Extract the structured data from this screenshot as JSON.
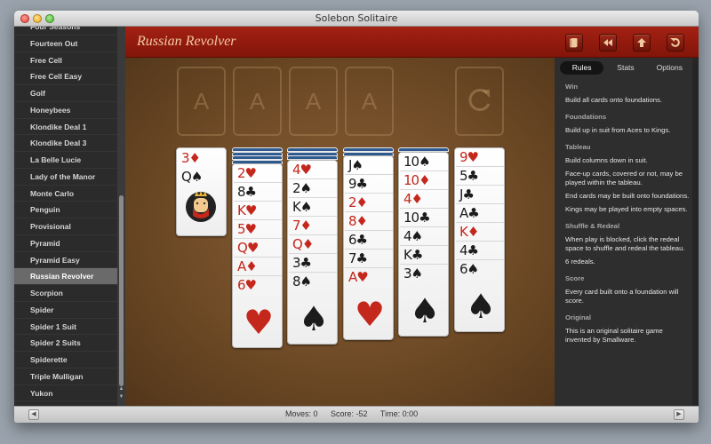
{
  "window": {
    "title": "Solebon Solitaire"
  },
  "sidebar": {
    "items": [
      {
        "label": "Four Seasons"
      },
      {
        "label": "Fourteen Out"
      },
      {
        "label": "Free Cell"
      },
      {
        "label": "Free Cell Easy"
      },
      {
        "label": "Golf"
      },
      {
        "label": "Honeybees"
      },
      {
        "label": "Klondike Deal 1"
      },
      {
        "label": "Klondike Deal 3"
      },
      {
        "label": "La Belle Lucie"
      },
      {
        "label": "Lady of the Manor"
      },
      {
        "label": "Monte Carlo"
      },
      {
        "label": "Penguin"
      },
      {
        "label": "Provisional"
      },
      {
        "label": "Pyramid"
      },
      {
        "label": "Pyramid Easy"
      },
      {
        "label": "Russian Revolver",
        "selected": true
      },
      {
        "label": "Scorpion"
      },
      {
        "label": "Spider"
      },
      {
        "label": "Spider 1 Suit"
      },
      {
        "label": "Spider 2 Suits"
      },
      {
        "label": "Spiderette"
      },
      {
        "label": "Triple Mulligan"
      },
      {
        "label": "Yukon"
      }
    ]
  },
  "header": {
    "game_title": "Russian Revolver",
    "buttons": [
      "deck-icon",
      "rewind-icon",
      "up-arrow-icon",
      "undo-icon"
    ]
  },
  "board": {
    "foundations": [
      "A",
      "A",
      "A",
      "A"
    ],
    "redeal_slot_icon": "redeal-arrow-icon",
    "reserve": {
      "cards": [
        {
          "rank": "3",
          "suit": "♦",
          "color": "red"
        },
        {
          "rank": "Q",
          "suit": "♠",
          "color": "black"
        }
      ],
      "face": "queen-face-icon"
    },
    "columns": [
      {
        "backs": 4,
        "cards": [
          {
            "rank": "2",
            "suit": "♥",
            "color": "red"
          },
          {
            "rank": "8",
            "suit": "♣",
            "color": "black"
          },
          {
            "rank": "K",
            "suit": "♥",
            "color": "red"
          },
          {
            "rank": "5",
            "suit": "♥",
            "color": "red"
          },
          {
            "rank": "Q",
            "suit": "♥",
            "color": "red"
          },
          {
            "rank": "A",
            "suit": "♦",
            "color": "red"
          },
          {
            "rank": "6",
            "suit": "♥",
            "color": "red"
          }
        ]
      },
      {
        "backs": 3,
        "cards": [
          {
            "rank": "4",
            "suit": "♥",
            "color": "red"
          },
          {
            "rank": "2",
            "suit": "♠",
            "color": "black"
          },
          {
            "rank": "K",
            "suit": "♠",
            "color": "black"
          },
          {
            "rank": "7",
            "suit": "♦",
            "color": "red"
          },
          {
            "rank": "Q",
            "suit": "♦",
            "color": "red"
          },
          {
            "rank": "3",
            "suit": "♣",
            "color": "black"
          },
          {
            "rank": "8",
            "suit": "♠",
            "color": "black"
          }
        ]
      },
      {
        "backs": 2,
        "cards": [
          {
            "rank": "J",
            "suit": "♠",
            "color": "black"
          },
          {
            "rank": "9",
            "suit": "♣",
            "color": "black"
          },
          {
            "rank": "2",
            "suit": "♦",
            "color": "red"
          },
          {
            "rank": "8",
            "suit": "♦",
            "color": "red"
          },
          {
            "rank": "6",
            "suit": "♣",
            "color": "black"
          },
          {
            "rank": "7",
            "suit": "♣",
            "color": "black"
          },
          {
            "rank": "A",
            "suit": "♥",
            "color": "red"
          }
        ]
      },
      {
        "backs": 1,
        "cards": [
          {
            "rank": "10",
            "suit": "♠",
            "color": "black"
          },
          {
            "rank": "10",
            "suit": "♦",
            "color": "red"
          },
          {
            "rank": "4",
            "suit": "♦",
            "color": "red"
          },
          {
            "rank": "10",
            "suit": "♣",
            "color": "black"
          },
          {
            "rank": "4",
            "suit": "♠",
            "color": "black"
          },
          {
            "rank": "K",
            "suit": "♣",
            "color": "black"
          },
          {
            "rank": "3",
            "suit": "♠",
            "color": "black"
          }
        ]
      },
      {
        "backs": 0,
        "cards": [
          {
            "rank": "9",
            "suit": "♥",
            "color": "red"
          },
          {
            "rank": "5",
            "suit": "♣",
            "color": "black"
          },
          {
            "rank": "J",
            "suit": "♣",
            "color": "black"
          },
          {
            "rank": "A",
            "suit": "♣",
            "color": "black"
          },
          {
            "rank": "K",
            "suit": "♦",
            "color": "red"
          },
          {
            "rank": "4",
            "suit": "♣",
            "color": "black"
          },
          {
            "rank": "6",
            "suit": "♠",
            "color": "black"
          }
        ]
      }
    ]
  },
  "panel": {
    "tabs": [
      {
        "label": "Rules",
        "active": true
      },
      {
        "label": "Stats"
      },
      {
        "label": "Options"
      }
    ],
    "sections": [
      {
        "heading": "Win",
        "paragraphs": [
          "Build all cards onto foundations."
        ]
      },
      {
        "heading": "Foundations",
        "paragraphs": [
          "Build up in suit from Aces to Kings."
        ]
      },
      {
        "heading": "Tableau",
        "paragraphs": [
          "Build columns down in suit.",
          "Face-up cards, covered or not, may be played within the tableau.",
          "End cards may be built onto foundations.",
          "Kings may be played into empty spaces."
        ]
      },
      {
        "heading": "Shuffle & Redeal",
        "paragraphs": [
          "When play is blocked, click the redeal space to shuffle and redeal the tableau.",
          "6 redeals."
        ]
      },
      {
        "heading": "Score",
        "paragraphs": [
          "Every card built onto a foundation will score."
        ]
      },
      {
        "heading": "Original",
        "paragraphs": [
          "This is an original solitaire game invented by Smallware."
        ]
      }
    ]
  },
  "status": {
    "moves": "Moves: 0",
    "score": "Score: -52",
    "time": "Time: 0:00"
  },
  "colors": {
    "header_red": "#9a1e10",
    "felt": "#7a5230",
    "sidebar": "#2b2b2b",
    "card_red": "#c4271c"
  }
}
